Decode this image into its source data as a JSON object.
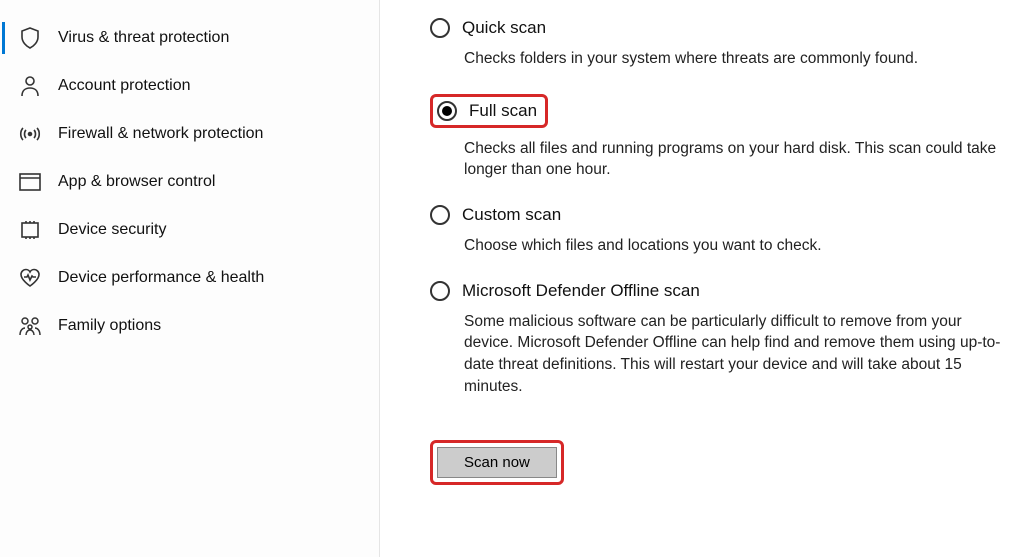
{
  "sidebar": {
    "items": [
      {
        "label": "Virus & threat protection"
      },
      {
        "label": "Account protection"
      },
      {
        "label": "Firewall & network protection"
      },
      {
        "label": "App & browser control"
      },
      {
        "label": "Device security"
      },
      {
        "label": "Device performance & health"
      },
      {
        "label": "Family options"
      }
    ]
  },
  "scan": {
    "quick": {
      "title": "Quick scan",
      "desc": "Checks folders in your system where threats are commonly found."
    },
    "full": {
      "title": "Full scan",
      "desc": "Checks all files and running programs on your hard disk. This scan could take longer than one hour."
    },
    "custom": {
      "title": "Custom scan",
      "desc": "Choose which files and locations you want to check."
    },
    "offline": {
      "title": "Microsoft Defender Offline scan",
      "desc": "Some malicious software can be particularly difficult to remove from your device. Microsoft Defender Offline can help find and remove them using up-to-date threat definitions. This will restart your device and will take about 15 minutes."
    },
    "button": "Scan now"
  }
}
